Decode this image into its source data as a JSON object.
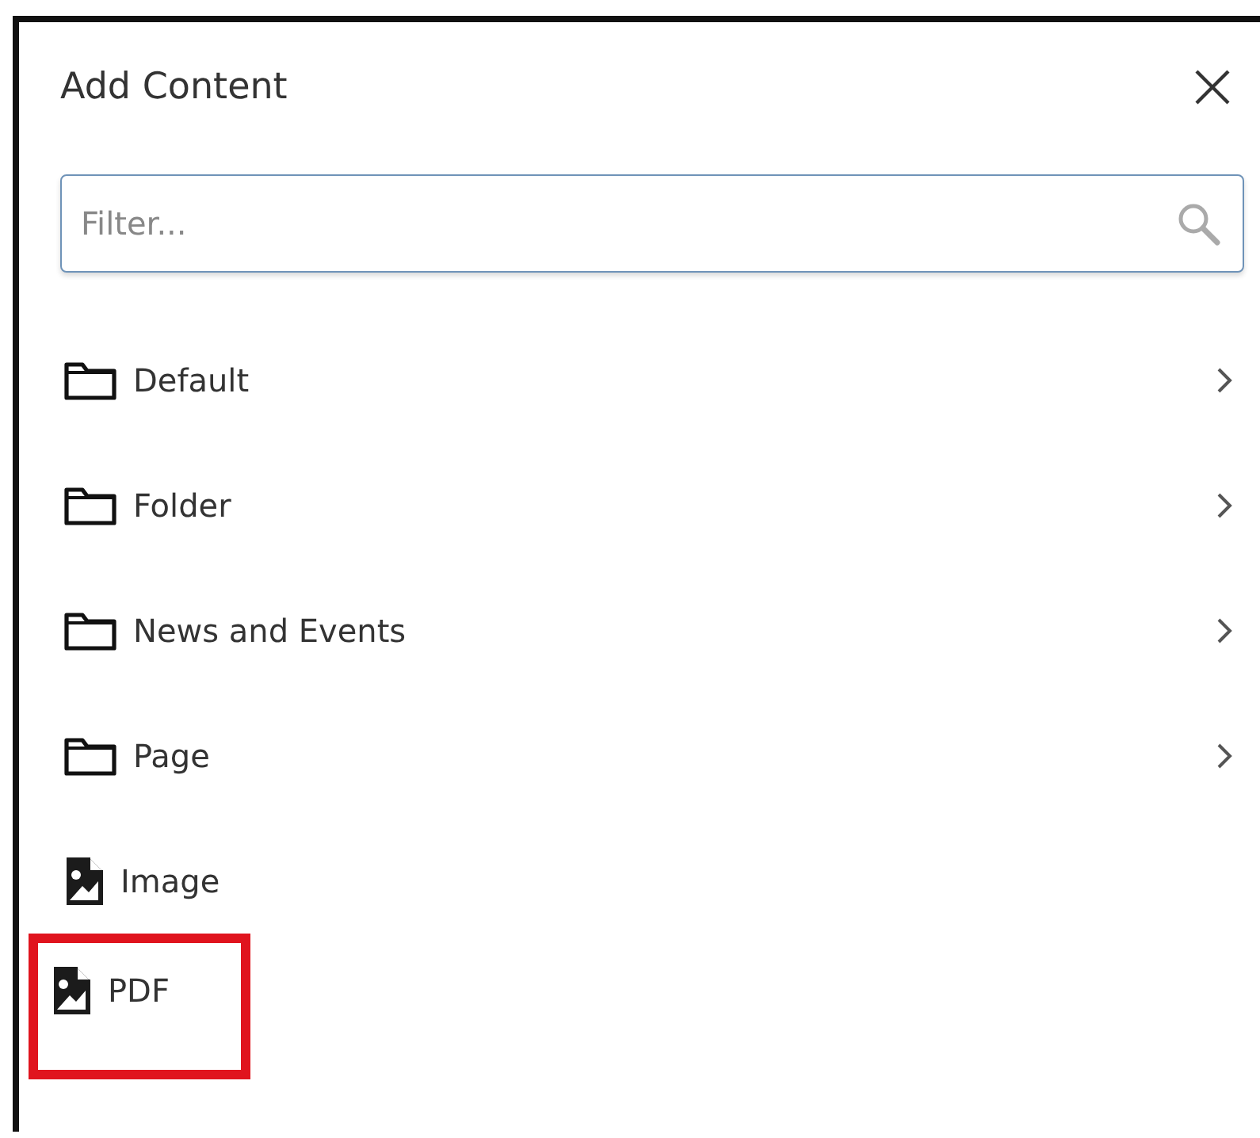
{
  "title": "Add Content",
  "filter": {
    "placeholder": "Filter..."
  },
  "items": [
    {
      "label": "Default",
      "kind": "folder",
      "highlighted": false
    },
    {
      "label": "Folder",
      "kind": "folder",
      "highlighted": false
    },
    {
      "label": "News and Events",
      "kind": "folder",
      "highlighted": false
    },
    {
      "label": "Page",
      "kind": "folder",
      "highlighted": false
    },
    {
      "label": "Image",
      "kind": "file",
      "highlighted": false
    },
    {
      "label": "PDF",
      "kind": "file",
      "highlighted": true
    }
  ]
}
